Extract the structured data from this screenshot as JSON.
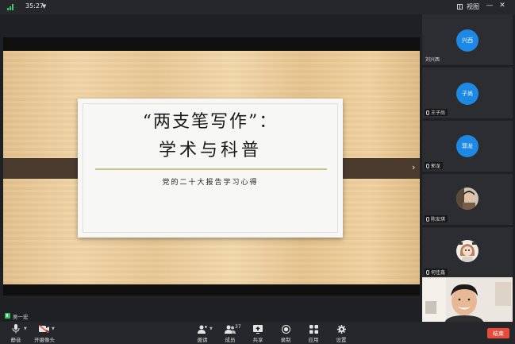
{
  "topbar": {
    "timer": "35:27",
    "view_label": "视图",
    "minimize_glyph": "—",
    "close_glyph": "✕",
    "caret_glyph": "▼"
  },
  "slide": {
    "title_line1": "“两支笔写作”：",
    "title_line2": "学术与科普",
    "subtitle": "党的二十大报告学习心得"
  },
  "next_arrow": "›",
  "speaker": {
    "name": "吴一宏"
  },
  "participants": [
    {
      "avatar_text": "兴西",
      "name": "刘兴西",
      "avatar_type": "initials"
    },
    {
      "avatar_text": "子尚",
      "name": "王子尚",
      "avatar_type": "initials"
    },
    {
      "avatar_text": "郭龙",
      "name": "郭龙",
      "avatar_type": "initials"
    },
    {
      "avatar_text": "",
      "name": "陈安琪",
      "avatar_type": "photo"
    },
    {
      "avatar_text": "",
      "name": "何佳鑫",
      "avatar_type": "photo"
    }
  ],
  "toolbar": {
    "mute_label": "静音",
    "camera_label": "开摄像头",
    "invite_label": "邀请",
    "members_label": "成员",
    "members_count": "37",
    "share_label": "共享",
    "record_label": "录制",
    "apps_label": "应用",
    "settings_label": "设置",
    "end_label": "结束"
  },
  "colors": {
    "avatar_blue": "#1e88e5",
    "end_red": "#e74b3c",
    "speaking_green": "#2fbf5e"
  }
}
